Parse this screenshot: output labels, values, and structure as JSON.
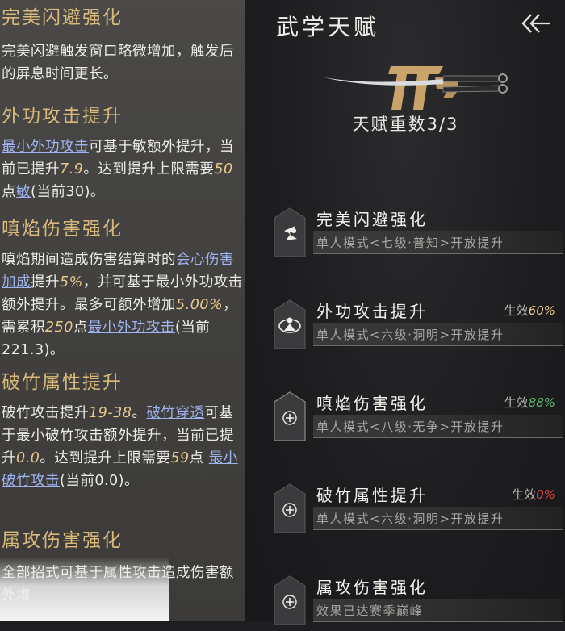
{
  "colors": {
    "gold": "#d8b97a",
    "link": "#9fb4f0",
    "green": "#5fbf6a",
    "red": "#e2463b"
  },
  "left": {
    "s1": {
      "title": "完美闪避强化",
      "text": "完美闪避触发窗口略微增加，触发后的屏息时间更长。"
    },
    "s2": {
      "title": "外功攻击提升",
      "link1": "最小外功攻击",
      "t1": "可基于敏额外提升，当前已提升",
      "v1": "7.9",
      "t2": "。达到提升上限需要",
      "v2": "50",
      "t3": "点",
      "link2": "敏",
      "t4": "(当前30)。"
    },
    "s3": {
      "title": "嗔焰伤害强化",
      "t1": "嗔焰期间造成伤害结算时的",
      "link1": "会心伤害加成",
      "t2": "提升",
      "v1": "5%",
      "t3": "，并可基于最小外功攻击额外提升。最多可额外增加",
      "v2": "5.00%",
      "t4": "，需累积",
      "v3": "250",
      "t5": "点",
      "link2": "最小外功攻击",
      "t6": "(当前221.3)。"
    },
    "s4": {
      "title": "破竹属性提升",
      "t1": "破竹攻击提升",
      "v1": "19-38",
      "t2": "。",
      "link1": "破竹穿透",
      "t3": "可基于最小破竹攻击额外提升，当前已提升",
      "v2": "0.0",
      "t4": "。达到提升上限需要",
      "v3": "59",
      "t5": "点 ",
      "link2": "最小破竹攻击",
      "t6": "(当前0.0)。"
    },
    "s5": {
      "title": "属攻伤害强化",
      "text": "全部招式可基于属性攻击造成伤害额外增"
    }
  },
  "right": {
    "title": "武学天赋",
    "back_icon": "double-chevron-left-icon",
    "weapon_icon": "sword-emblem-icon",
    "rank_label": "天赋重数3/3",
    "talents": [
      {
        "name": "完美闪避强化",
        "desc": "单人模式<七级·普知>开放提升",
        "effect_label": "",
        "effect_value": "",
        "effect_color": "",
        "icon": "dodge-icon"
      },
      {
        "name": "外功攻击提升",
        "desc": "单人模式<六级·洞明>开放提升",
        "effect_label": "生效",
        "effect_value": "60%",
        "effect_color": "#e8c98a",
        "icon": "martial-figure-icon"
      },
      {
        "name": "嗔焰伤害强化",
        "desc": "单人模式<八级·无争>开放提升",
        "effect_label": "生效",
        "effect_value": "88%",
        "effect_color": "#5fbf6a",
        "icon": "plus-icon"
      },
      {
        "name": "破竹属性提升",
        "desc": "单人模式<六级·洞明>开放提升",
        "effect_label": "生效",
        "effect_value": "0%",
        "effect_color": "#e2463b",
        "icon": "plus-icon"
      },
      {
        "name": "属攻伤害强化",
        "desc": "效果已达赛季巅峰",
        "effect_label": "",
        "effect_value": "",
        "effect_color": "",
        "icon": "plus-icon"
      }
    ]
  }
}
